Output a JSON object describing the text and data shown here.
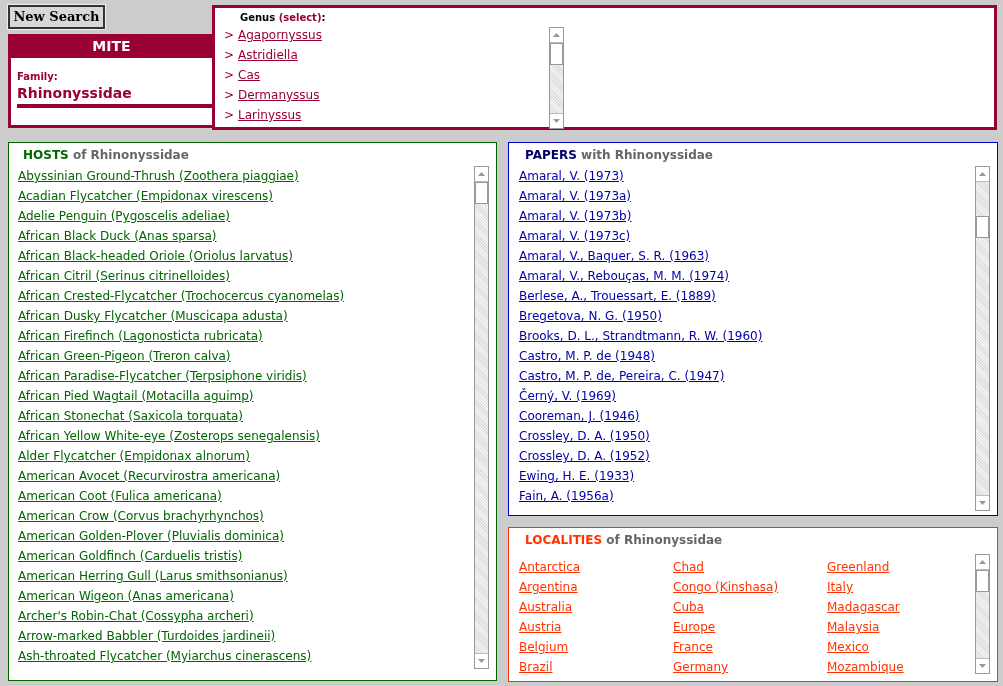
{
  "new_search_button": "New Search",
  "mite": {
    "title": "MITE",
    "family_label": "Family:",
    "family": "Rhinonyssidae"
  },
  "genus": {
    "label": "Genus",
    "accent": "(select)",
    "tail": ":",
    "items": [
      {
        "bullet": ">",
        "name": "Agapornyssus"
      },
      {
        "bullet": ">",
        "name": "Astridiella"
      },
      {
        "bullet": ">",
        "name": "Cas"
      },
      {
        "bullet": ">",
        "name": "Dermanyssus"
      },
      {
        "bullet": ">",
        "name": "Larinyssus"
      }
    ]
  },
  "hosts": {
    "lead": "HOSTS",
    "rest": "of Rhinonyssidae",
    "items": [
      "Abyssinian Ground-Thrush (Zoothera piaggiae)",
      "Acadian Flycatcher (Empidonax virescens)",
      "Adelie Penguin (Pygoscelis adeliae)",
      "African Black Duck (Anas sparsa)",
      "African Black-headed Oriole (Oriolus larvatus)",
      "African Citril (Serinus citrinelloides)",
      "African Crested-Flycatcher (Trochocercus cyanomelas)",
      "African Dusky Flycatcher (Muscicapa adusta)",
      "African Firefinch (Lagonosticta rubricata)",
      "African Green-Pigeon (Treron calva)",
      "African Paradise-Flycatcher (Terpsiphone viridis)",
      "African Pied Wagtail (Motacilla aguimp)",
      "African Stonechat (Saxicola torquata)",
      "African Yellow White-eye (Zosterops senegalensis)",
      "Alder Flycatcher (Empidonax alnorum)",
      "American Avocet (Recurvirostra americana)",
      "American Coot (Fulica americana)",
      "American Crow (Corvus brachyrhynchos)",
      "American Golden-Plover (Pluvialis dominica)",
      "American Goldfinch (Carduelis tristis)",
      "American Herring Gull (Larus smithsonianus)",
      "American Wigeon (Anas americana)",
      "Archer's Robin-Chat (Cossypha archeri)",
      "Arrow-marked Babbler (Turdoides jardineii)",
      "Ash-throated Flycatcher (Myiarchus cinerascens)"
    ]
  },
  "papers": {
    "lead": "PAPERS",
    "rest": "with Rhinonyssidae",
    "items": [
      "Amaral, V. (1973)",
      "Amaral, V. (1973a)",
      "Amaral, V. (1973b)",
      "Amaral, V. (1973c)",
      "Amaral, V., Baquer, S. R. (1963)",
      "Amaral, V., Rebouças, M. M. (1974)",
      "Berlese, A., Trouessart, E. (1889)",
      "Bregetova, N. G. (1950)",
      "Brooks, D. L., Strandtmann, R. W. (1960)",
      "Castro, M. P. de (1948)",
      "Castro, M. P. de, Pereira, C. (1947)",
      "Černý, V. (1969)",
      "Cooreman, J. (1946)",
      "Crossley, D. A. (1950)",
      "Crossley, D. A. (1952)",
      "Ewing, H. E. (1933)",
      "Fain, A. (1956a)"
    ]
  },
  "localities": {
    "lead": "LOCALITIES",
    "rest": "of Rhinonyssidae",
    "items": [
      "Antarctica",
      "Argentina",
      "Australia",
      "Austria",
      "Belgium",
      "Brazil",
      "Chad",
      "Congo (Kinshasa)",
      "Cuba",
      "Europe",
      "France",
      "Germany",
      "Greenland",
      "Italy",
      "Madagascar",
      "Malaysia",
      "Mexico",
      "Mozambique"
    ]
  }
}
